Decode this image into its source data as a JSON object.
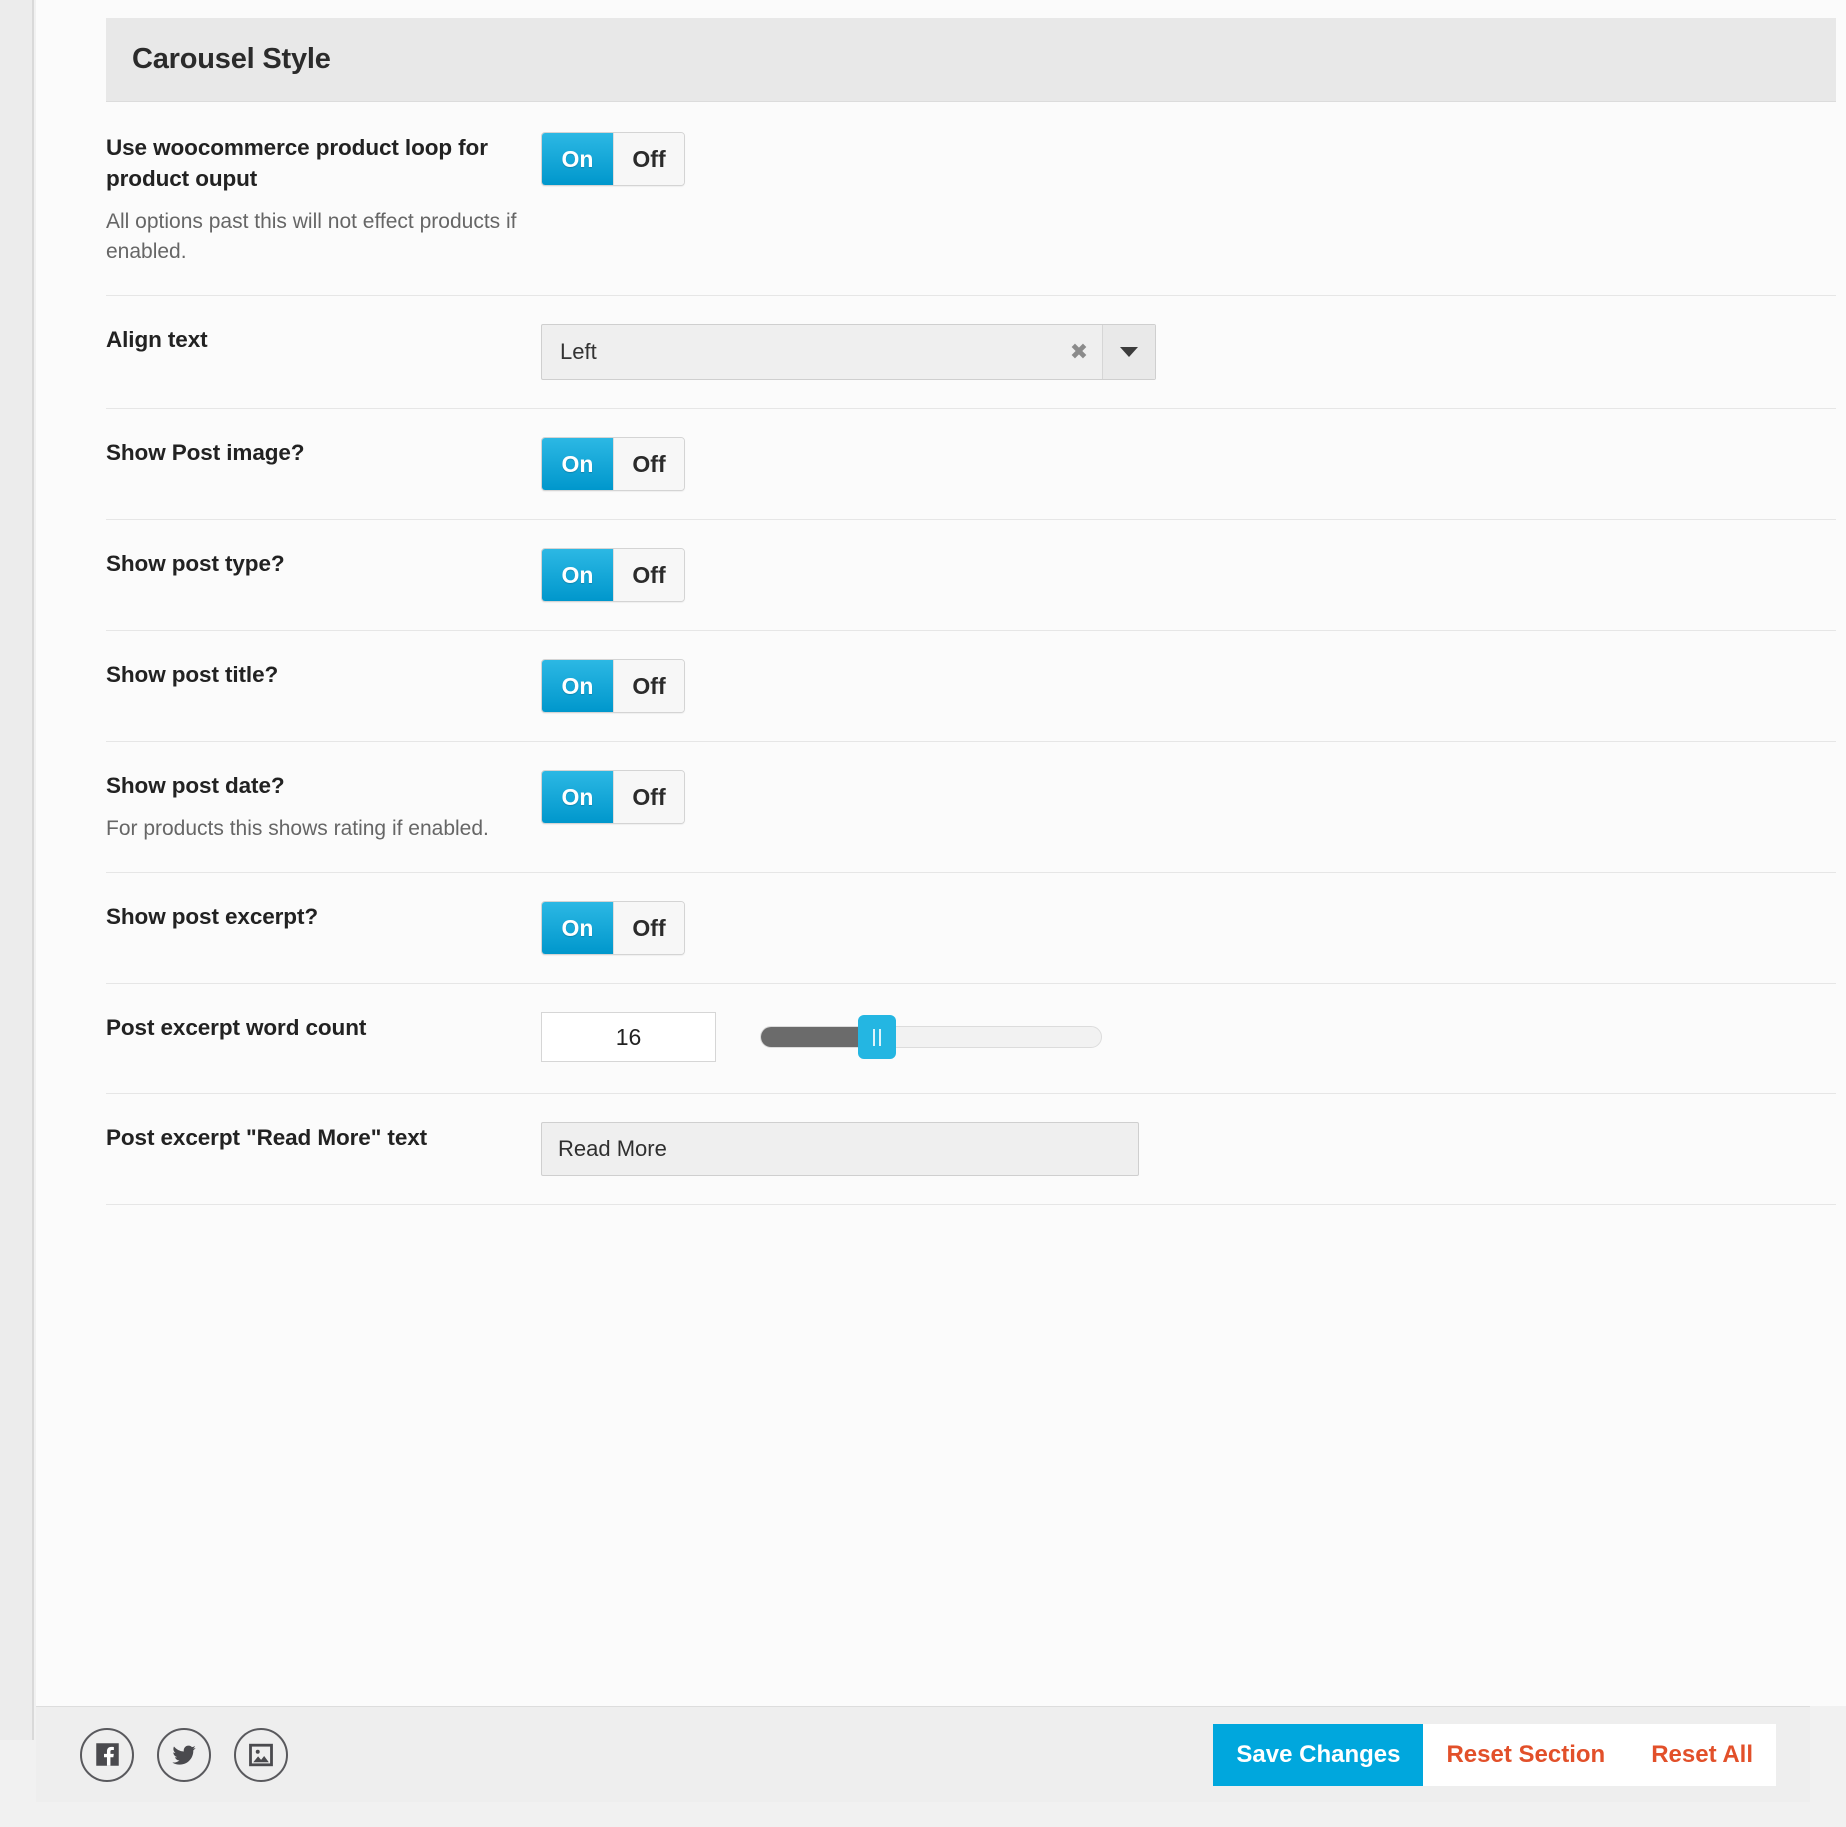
{
  "section": {
    "title": "Carousel Style"
  },
  "rows": [
    {
      "label": "Use woocommerce product loop for product ouput",
      "description": "All options past this will not effect products if enabled.",
      "type": "toggle",
      "on_label": "On",
      "off_label": "Off",
      "value": "On"
    },
    {
      "label": "Align text",
      "description": "",
      "type": "select",
      "value": "Left",
      "clear_icon": "clear-x-icon",
      "arrow_icon": "chevron-down-icon"
    },
    {
      "label": "Show Post image?",
      "description": "",
      "type": "toggle",
      "on_label": "On",
      "off_label": "Off",
      "value": "On"
    },
    {
      "label": "Show post type?",
      "description": "",
      "type": "toggle",
      "on_label": "On",
      "off_label": "Off",
      "value": "On"
    },
    {
      "label": "Show post title?",
      "description": "",
      "type": "toggle",
      "on_label": "On",
      "off_label": "Off",
      "value": "On"
    },
    {
      "label": "Show post date?",
      "description": "For products this shows rating if enabled.",
      "type": "toggle",
      "on_label": "On",
      "off_label": "Off",
      "value": "On"
    },
    {
      "label": "Show post excerpt?",
      "description": "",
      "type": "toggle",
      "on_label": "On",
      "off_label": "Off",
      "value": "On"
    },
    {
      "label": "Post excerpt word count",
      "description": "",
      "type": "slider",
      "value": "16"
    },
    {
      "label": "Post excerpt \"Read More\" text",
      "description": "",
      "type": "text",
      "value": "Read More"
    }
  ],
  "footer": {
    "social": [
      {
        "name": "facebook-icon"
      },
      {
        "name": "twitter-icon"
      },
      {
        "name": "image-icon"
      }
    ],
    "save_label": "Save Changes",
    "reset_section_label": "Reset Section",
    "reset_all_label": "Reset All"
  },
  "colors": {
    "accent": "#00a7dd",
    "toggle_on": "#0097cc",
    "reset_text": "#e2502a",
    "slider_fill": "#6b6b6b",
    "slider_handle": "#24b6e2",
    "header_bg": "#e8e8e8"
  }
}
